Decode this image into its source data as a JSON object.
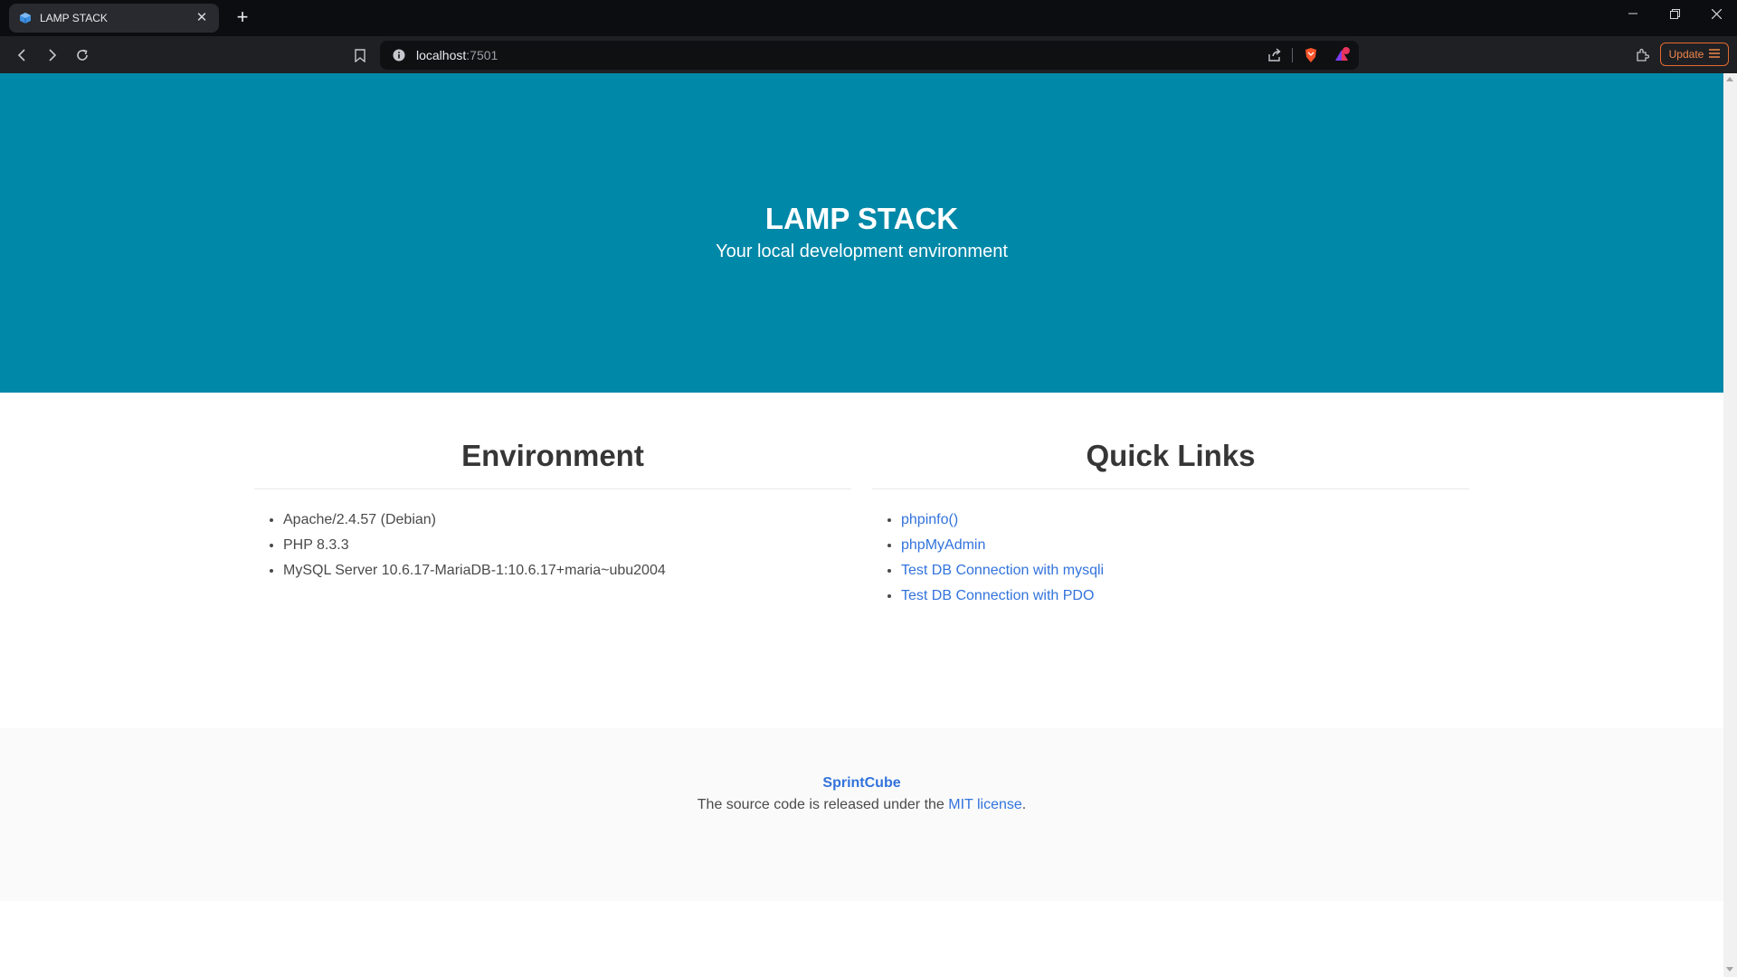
{
  "browser": {
    "tab": {
      "title": "LAMP STACK"
    },
    "url": {
      "host": "localhost",
      "port": ":7501"
    },
    "update_label": "Update",
    "notification_count": "1"
  },
  "hero": {
    "title": "LAMP STACK",
    "subtitle": "Your local development environment"
  },
  "environment": {
    "heading": "Environment",
    "items": [
      "Apache/2.4.57 (Debian)",
      "PHP 8.3.3",
      "MySQL Server 10.6.17-MariaDB-1:10.6.17+maria~ubu2004"
    ]
  },
  "quick_links": {
    "heading": "Quick Links",
    "links": [
      "phpinfo()",
      "phpMyAdmin",
      "Test DB Connection with mysqli",
      "Test DB Connection with PDO"
    ]
  },
  "footer": {
    "brand": "SprintCube",
    "license_prefix": "The source code is released under the ",
    "license_link": "MIT license",
    "license_suffix": "."
  },
  "colors": {
    "hero_bg": "#0088a8",
    "link": "#3273dc",
    "update_accent": "#e56b2e"
  }
}
